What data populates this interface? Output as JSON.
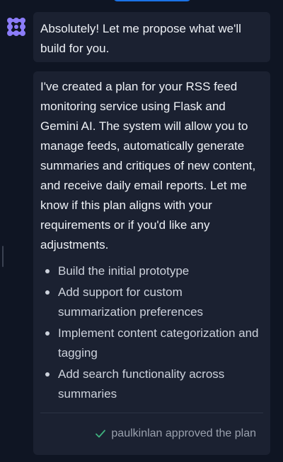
{
  "conversation": {
    "assistant_icon": "gemini-flower-icon",
    "intro_message": "Absolutely! Let me propose what we'll build for you.",
    "plan_message": "I've created a plan for your RSS feed monitoring service using Flask and Gemini AI. The system will allow you to manage feeds, automatically generate summaries and critiques of new content, and receive daily email reports. Let me know if this plan aligns with your requirements or if you'd like any adjustments.",
    "plan_steps": [
      "Build the initial prototype",
      "Add support for custom summarization preferences",
      "Implement content categorization and tagging",
      "Add search functionality across summaries"
    ],
    "approval": {
      "icon": "check-icon",
      "text": "paulkinlan approved the plan"
    }
  },
  "colors": {
    "background": "#0f1523",
    "bubble": "#1b2131",
    "accent": "#7b6cf6",
    "approved": "#3fb27f"
  }
}
